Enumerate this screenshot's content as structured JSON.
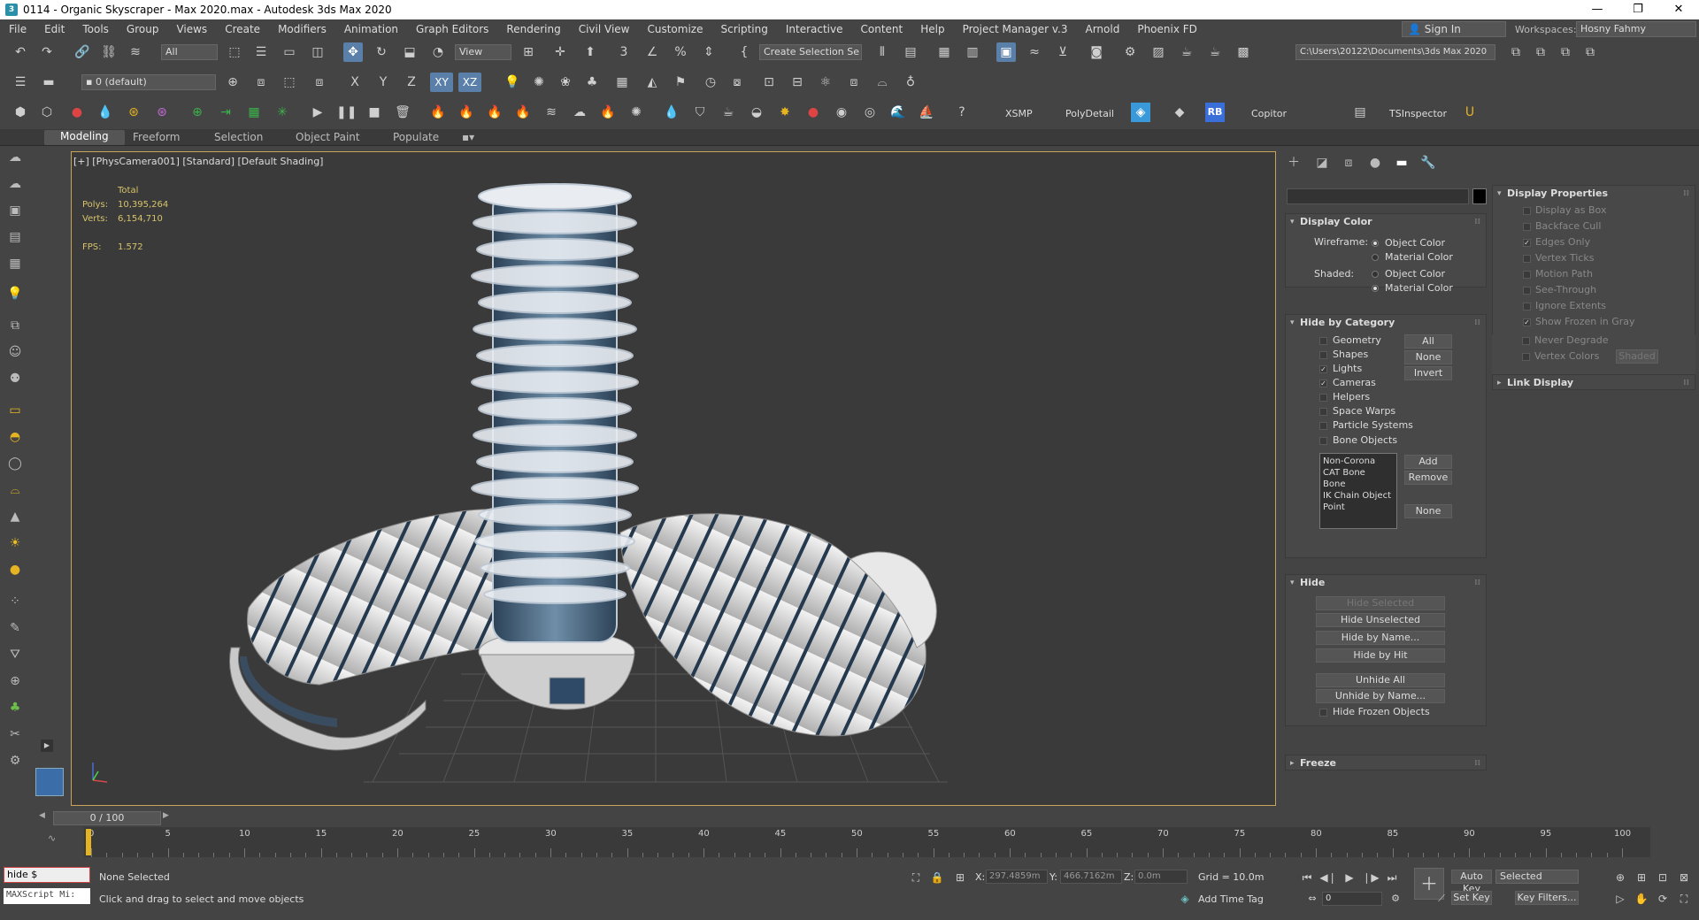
{
  "title": "0114 - Organic Skyscraper - Max 2020.max - Autodesk 3ds Max 2020",
  "menu": [
    "File",
    "Edit",
    "Tools",
    "Group",
    "Views",
    "Create",
    "Modifiers",
    "Animation",
    "Graph Editors",
    "Rendering",
    "Civil View",
    "Customize",
    "Scripting",
    "Interactive",
    "Content",
    "Help",
    "Project Manager v.3",
    "Arnold",
    "Phoenix FD"
  ],
  "account": {
    "sign_in": "Sign In",
    "workspaces_label": "Workspaces:",
    "workspace": "Hosny Fahmy"
  },
  "toolbar1": {
    "filter": "All",
    "refcoord": "View",
    "selection_set": "Create Selection Se",
    "path": "C:\\Users\\20122\\Documents\\3ds Max 2020"
  },
  "toolbar2": {
    "layer": "0 (default)",
    "axis_x": "X",
    "axis_y": "Y",
    "axis_z": "Z",
    "axis_xy": "XY",
    "axis_xz": "XZ"
  },
  "toolbar3": {
    "xsmp": "XSMP",
    "polydetail": "PolyDetail",
    "rb": "RB",
    "copitor": "Copitor",
    "tsinspector": "TSInspector"
  },
  "ribbon_tabs": [
    "Modeling",
    "Freeform",
    "Selection",
    "Object Paint",
    "Populate"
  ],
  "viewport": {
    "label": "[+] [PhysCamera001] [Standard] [Default Shading]",
    "stats": {
      "total_label": "Total",
      "polys_label": "Polys:",
      "polys": "10,395,264",
      "verts_label": "Verts:",
      "verts": "6,154,710",
      "fps_label": "FPS:",
      "fps": "1.572"
    }
  },
  "display_color": {
    "header": "Display Color",
    "wireframe_label": "Wireframe:",
    "shaded_label": "Shaded:",
    "object_color": "Object Color",
    "material_color": "Material Color"
  },
  "hide_by_category": {
    "header": "Hide by Category",
    "items": [
      {
        "label": "Geometry",
        "checked": false
      },
      {
        "label": "Shapes",
        "checked": false
      },
      {
        "label": "Lights",
        "checked": true
      },
      {
        "label": "Cameras",
        "checked": true
      },
      {
        "label": "Helpers",
        "checked": false
      },
      {
        "label": "Space Warps",
        "checked": false
      },
      {
        "label": "Particle Systems",
        "checked": false
      },
      {
        "label": "Bone Objects",
        "checked": false
      }
    ],
    "btn_all": "All",
    "btn_none": "None",
    "btn_invert": "Invert",
    "list": [
      "Non-Corona",
      "CAT Bone",
      "Bone",
      "IK Chain Object",
      "Point"
    ],
    "btn_add": "Add",
    "btn_remove": "Remove",
    "btn_none2": "None"
  },
  "hide": {
    "header": "Hide",
    "hide_selected": "Hide Selected",
    "hide_unselected": "Hide Unselected",
    "hide_by_name": "Hide by Name...",
    "hide_by_hit": "Hide by Hit",
    "unhide_all": "Unhide All",
    "unhide_by_name": "Unhide by Name...",
    "hide_frozen": "Hide Frozen Objects"
  },
  "freeze": {
    "header": "Freeze"
  },
  "display_properties": {
    "header": "Display Properties",
    "items": [
      {
        "label": "Display as Box",
        "checked": false
      },
      {
        "label": "Backface Cull",
        "checked": false
      },
      {
        "label": "Edges Only",
        "checked": true
      },
      {
        "label": "Vertex Ticks",
        "checked": false
      },
      {
        "label": "Motion Path",
        "checked": false
      },
      {
        "label": "See-Through",
        "checked": false
      },
      {
        "label": "Ignore Extents",
        "checked": false
      },
      {
        "label": "Show Frozen in Gray",
        "checked": true
      },
      {
        "label": "Never Degrade",
        "checked": false
      },
      {
        "label": "Vertex Colors",
        "checked": false
      }
    ],
    "shaded_btn": "Shaded"
  },
  "link_display": {
    "header": "Link Display"
  },
  "timeline": {
    "slider": "0 / 100",
    "ticks": [
      "0",
      "5",
      "10",
      "15",
      "20",
      "25",
      "30",
      "35",
      "40",
      "45",
      "50",
      "55",
      "60",
      "65",
      "70",
      "75",
      "80",
      "85",
      "90",
      "95",
      "100"
    ]
  },
  "status": {
    "maxscript_input": "hide $",
    "maxscript_mini": "MAXScript Mi:",
    "selection": "None Selected",
    "prompt": "Click and drag to select and move objects",
    "x_label": "X:",
    "x": "297.4859m",
    "y_label": "Y:",
    "y": "466.7162m",
    "z_label": "Z:",
    "z": "0.0m",
    "grid": "Grid = 10.0m",
    "add_time_tag": "Add Time Tag",
    "auto_key": "Auto Key",
    "selected": "Selected",
    "set_key": "Set Key",
    "key_filters": "Key Filters...",
    "frame": "0"
  }
}
